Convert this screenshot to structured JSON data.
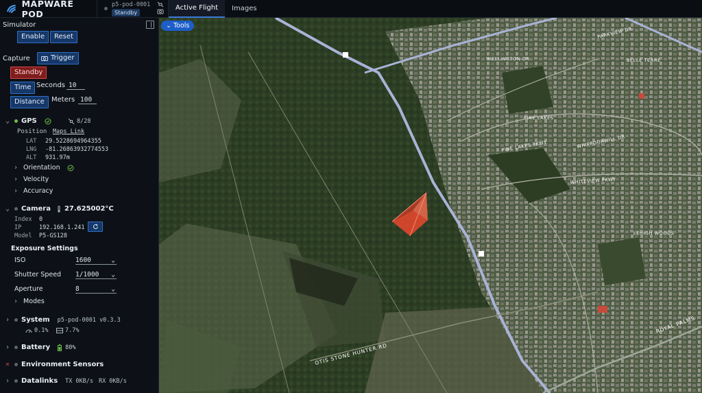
{
  "brand": {
    "name": "MAPWARE POD"
  },
  "pod": {
    "id": "p5-pod-0001",
    "state": "Standby"
  },
  "tabs": [
    {
      "label": "Active Flight"
    },
    {
      "label": "Images"
    }
  ],
  "map": {
    "tools_label": "Tools",
    "road_labels": [
      "PINE LAKES",
      "PINE LAKES PKWY",
      "WHIPPOORWILL DR",
      "WHITEVIEW PKWY",
      "BELLE TERRE",
      "WELLINGTON DR",
      "LEHIGH WOODS",
      "ROYAL PALMS",
      "OTIS STONE HUNTER RD",
      "PARKVIEW DR"
    ],
    "route_shield": "1"
  },
  "sidebar": {
    "simulator": {
      "title": "Simulator",
      "enable": "Enable",
      "reset": "Reset"
    },
    "capture": {
      "title": "Capture",
      "trigger": "Trigger",
      "standby": "Standby",
      "time": "Time",
      "seconds_label": "Seconds",
      "seconds_value": "10",
      "distance": "Distance",
      "meters_label": "Meters",
      "meters_value": "100"
    },
    "gps": {
      "title": "GPS",
      "sats": "8/28",
      "position_label": "Position",
      "maps_link": "Maps Link",
      "lat_label": "LAT",
      "lat": "29.5228694964355",
      "lng_label": "LNG",
      "lng": "-81.26863932774553",
      "alt_label": "ALT",
      "alt": "931.97m",
      "orientation": "Orientation",
      "velocity": "Velocity",
      "accuracy": "Accuracy"
    },
    "camera": {
      "title": "Camera",
      "temp": "27.625002°C",
      "index_label": "Index",
      "index": "0",
      "ip_label": "IP",
      "ip": "192.168.1.241",
      "model_label": "Model",
      "model": "P5-GS128"
    },
    "exposure": {
      "title": "Exposure Settings",
      "iso_label": "ISO",
      "iso": "1600",
      "shutter_label": "Shutter Speed",
      "shutter": "1/1000",
      "aperture_label": "Aperture",
      "aperture": "8",
      "modes": "Modes"
    },
    "system": {
      "title": "System",
      "version": "p5-pod-0001 v0.3.3",
      "cpu": "0.1%",
      "mem": "7.7%"
    },
    "battery": {
      "title": "Battery",
      "level": "80%"
    },
    "env": {
      "title": "Environment Sensors"
    },
    "datalinks": {
      "title": "Datalinks",
      "tx_label": "TX",
      "tx": "0KB/s",
      "rx_label": "RX",
      "rx": "0KB/s"
    }
  },
  "colors": {
    "accent": "#2f6fc8",
    "ok": "#6cc04a",
    "alert": "#d24545"
  }
}
